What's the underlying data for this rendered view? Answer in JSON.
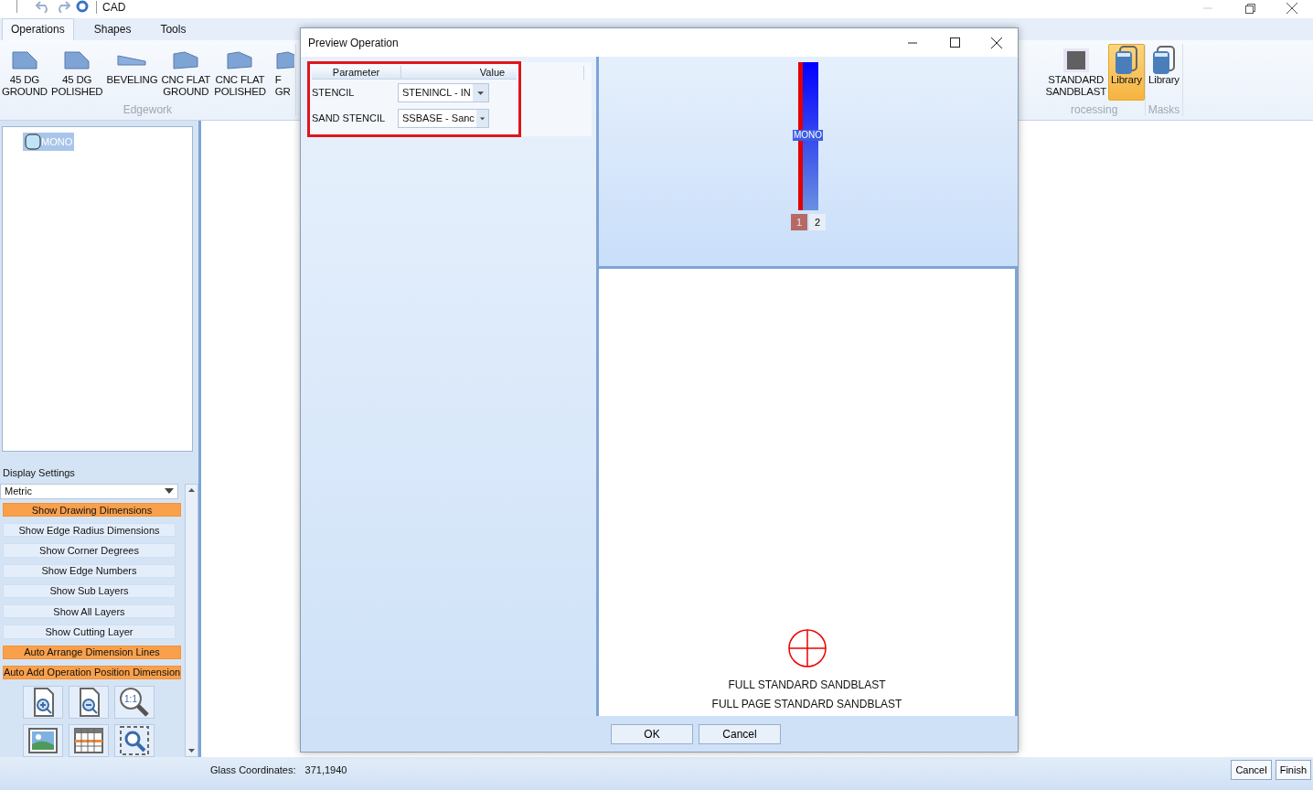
{
  "app": {
    "title": "CAD"
  },
  "tabs": [
    {
      "label": "Operations",
      "selected": true
    },
    {
      "label": "Shapes",
      "selected": false
    },
    {
      "label": "Tools",
      "selected": false
    }
  ],
  "ribbon_left": [
    {
      "label": "Edgework",
      "items": [
        {
          "lines": [
            "45 DG",
            "GROUND"
          ],
          "kind": "bevel45",
          "selected": false
        },
        {
          "lines": [
            "45 DG",
            "POLISHED"
          ],
          "kind": "bevel45",
          "selected": false
        },
        {
          "lines": [
            "BEVELING"
          ],
          "kind": "beveling",
          "selected": false
        },
        {
          "lines": [
            "CNC FLAT",
            "GROUND"
          ],
          "kind": "flat",
          "selected": false
        },
        {
          "lines": [
            "CNC FLAT",
            "POLISHED"
          ],
          "kind": "flat",
          "selected": false
        },
        {
          "lines": [
            "F",
            "GR"
          ],
          "kind": "flat",
          "selected": false,
          "cut_off": true
        }
      ]
    }
  ],
  "ribbon_right": [
    {
      "label": "rocessing",
      "items": [
        {
          "lines": [
            "STANDARD",
            "SANDBLAST"
          ],
          "kind": "sandblast",
          "selected": false
        },
        {
          "lines": [
            "Library"
          ],
          "kind": "library",
          "selected": true
        }
      ]
    },
    {
      "label": "Masks",
      "items": [
        {
          "lines": [
            "Library"
          ],
          "kind": "library",
          "selected": false
        }
      ]
    }
  ],
  "tree": {
    "items": [
      {
        "label": "MONO",
        "selected": true
      }
    ]
  },
  "display_settings": {
    "title": "Display Settings",
    "units": "Metric",
    "toggles": [
      {
        "label": "Show Drawing Dimensions",
        "on": true
      },
      {
        "label": "Show Edge Radius Dimensions",
        "on": false
      },
      {
        "label": "Show Corner Degrees",
        "on": false
      },
      {
        "label": "Show Edge Numbers",
        "on": false
      },
      {
        "label": "Show Sub Layers",
        "on": false
      },
      {
        "label": "Show All Layers",
        "on": false
      },
      {
        "label": "Show Cutting Layer",
        "on": false
      },
      {
        "label": "Auto Arrange Dimension Lines",
        "on": true
      },
      {
        "label": "Auto Add Operation Position Dimension",
        "on": true
      }
    ],
    "tools": [
      {
        "kind": "zoom-in"
      },
      {
        "kind": "zoom-out"
      },
      {
        "kind": "zoom-actual",
        "text": "1:1"
      },
      {
        "kind": "picture"
      },
      {
        "kind": "grid"
      },
      {
        "kind": "zoom-region"
      }
    ]
  },
  "status_bar": {
    "label": "Glass Coordinates:",
    "value": "371,1940",
    "buttons": [
      "Cancel",
      "Finish"
    ]
  },
  "dialog": {
    "title": "Preview Operation",
    "grid": {
      "highlighted": true,
      "columns": [
        "Parameter",
        "Value"
      ],
      "rows": [
        {
          "name": "STENCIL",
          "value": "STENINCL - IN"
        },
        {
          "name": "SAND STENCIL",
          "value": "SSBASE - Sanc"
        }
      ]
    },
    "preview": {
      "bar_label": "MONO",
      "pages": [
        {
          "label": "1",
          "selected": true
        },
        {
          "label": "2",
          "selected": false
        }
      ]
    },
    "operation": {
      "lines": [
        "FULL STANDARD SANDBLAST",
        "FULL PAGE STANDARD SANDBLAST"
      ]
    },
    "buttons": [
      "OK",
      "Cancel"
    ]
  }
}
